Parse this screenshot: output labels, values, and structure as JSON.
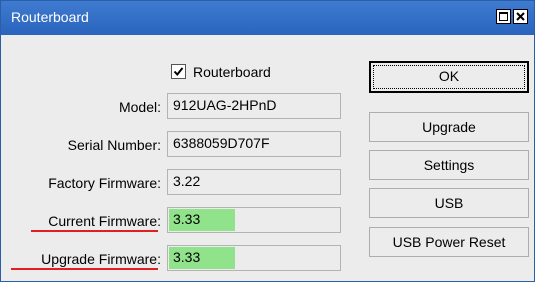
{
  "window": {
    "title": "Routerboard"
  },
  "checkbox": {
    "label": "Routerboard",
    "checked": true
  },
  "fields": {
    "model": {
      "label": "Model:",
      "value": "912UAG-2HPnD"
    },
    "serial_number": {
      "label": "Serial Number:",
      "value": "6388059D707F"
    },
    "factory_firmware": {
      "label": "Factory Firmware:",
      "value": "3.22"
    },
    "current_firmware": {
      "label": "Current Firmware:",
      "value": "3.33"
    },
    "upgrade_firmware": {
      "label": "Upgrade Firmware:",
      "value": "3.33"
    }
  },
  "buttons": {
    "ok": "OK",
    "upgrade": "Upgrade",
    "settings": "Settings",
    "usb": "USB",
    "usb_power_reset": "USB Power Reset"
  },
  "colors": {
    "titlebar": "#2f6cc6",
    "highlight": "#90e38a",
    "annotation_underline": "#e02020"
  }
}
